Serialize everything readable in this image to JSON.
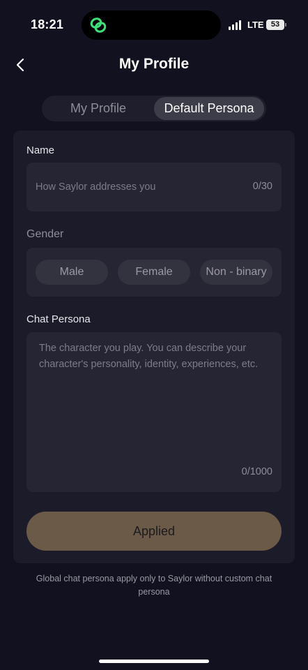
{
  "status_bar": {
    "time": "18:21",
    "network": "LTE",
    "battery": "53",
    "link_icon": "link-icon",
    "accent": "#3ee07a"
  },
  "header": {
    "title": "My Profile",
    "back_icon": "chevron-left-icon"
  },
  "tabs": [
    {
      "label": "My Profile",
      "selected": false
    },
    {
      "label": "Default Persona",
      "selected": true
    }
  ],
  "form": {
    "name": {
      "label": "Name",
      "placeholder": "How Saylor addresses you",
      "counter": "0/30"
    },
    "gender": {
      "label": "Gender",
      "options": [
        "Male",
        "Female",
        "Non - binary"
      ]
    },
    "chat_persona": {
      "label": "Chat Persona",
      "placeholder": "The character you play. You can describe your character's personality, identity, experiences, etc.",
      "counter": "0/1000"
    },
    "apply_button": "Applied"
  },
  "footnote": "Global  chat persona apply only to Saylor without custom chat persona",
  "colors": {
    "background": "#12111f",
    "card": "#1c1b2a",
    "button": "#6b5a48"
  }
}
